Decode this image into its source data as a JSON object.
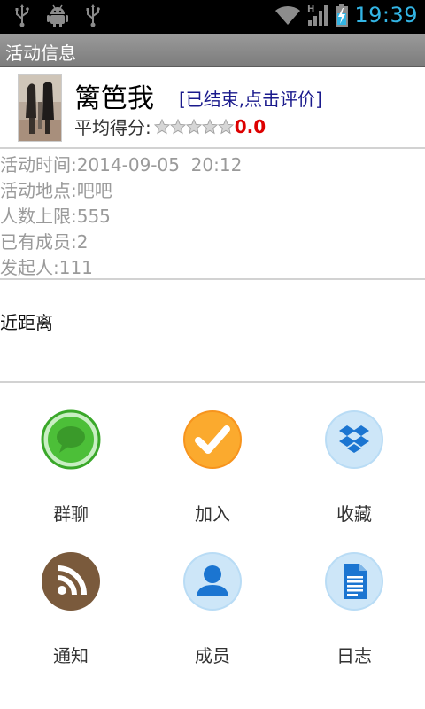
{
  "status_bar": {
    "time": "19:39",
    "icons": [
      "usb-icon",
      "android-debug-icon",
      "usb-icon",
      "wifi-icon",
      "signal-h-icon",
      "battery-charging-icon"
    ]
  },
  "title_bar": {
    "title": "活动信息"
  },
  "event": {
    "name": "篱笆我",
    "status": "[已结束,点击评价]",
    "rating_label": "平均得分:",
    "rating_value": "0.0",
    "stars_filled": 0,
    "stars_total": 5
  },
  "info": {
    "time": "活动时间:2014-09-05  20:12",
    "location": "活动地点:吧吧",
    "capacity": "人数上限:555",
    "members": "已有成员:2",
    "initiator": "发起人:111"
  },
  "description": "近距离",
  "actions": [
    {
      "label": "群聊",
      "icon": "chat-bubble-icon",
      "color": "#3aa82a"
    },
    {
      "label": "加入",
      "icon": "checkmark-icon",
      "color": "#f7941d"
    },
    {
      "label": "收藏",
      "icon": "dropbox-icon",
      "color": "#1b75d1"
    },
    {
      "label": "通知",
      "icon": "rss-icon",
      "color": "#7a5a3c"
    },
    {
      "label": "成员",
      "icon": "person-icon",
      "color": "#1b75d1"
    },
    {
      "label": "日志",
      "icon": "document-icon",
      "color": "#1b75d1"
    }
  ],
  "colors": {
    "status_accent": "#33b5e5",
    "title_bar": "#8a8a8a",
    "event_status": "#1a1a8c",
    "rating_value": "#dd0000",
    "info_text": "#9a9a9a"
  }
}
